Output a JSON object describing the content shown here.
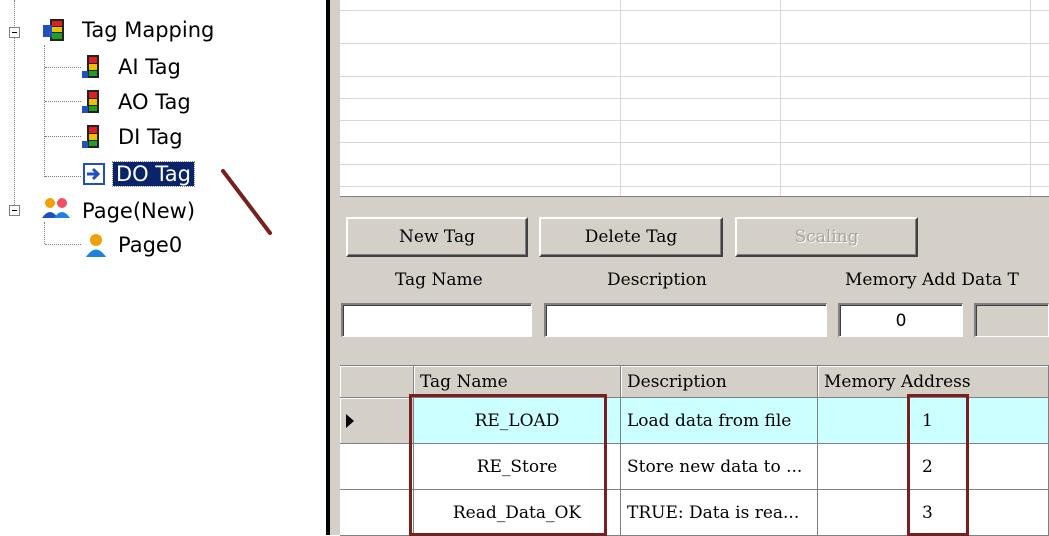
{
  "tree": {
    "nodes": [
      {
        "label": "Tag Mapping",
        "icon": "tag-mapping-icon"
      },
      {
        "label": "AI Tag",
        "icon": "tag-level-icon"
      },
      {
        "label": "AO Tag",
        "icon": "tag-level-icon"
      },
      {
        "label": "DI Tag",
        "icon": "tag-level-icon"
      },
      {
        "label": "DO Tag",
        "icon": "arrow-right-icon",
        "selected": true
      },
      {
        "label": "Page(New)",
        "icon": "users-group-icon"
      },
      {
        "label": "Page0",
        "icon": "user-icon"
      }
    ]
  },
  "toolbar": {
    "new_tag": "New Tag",
    "delete_tag": "Delete Tag",
    "scaling": "Scaling"
  },
  "form": {
    "tag_name_label": "Tag Name",
    "description_label": "Description",
    "memory_data_label": "Memory Add Data T",
    "tag_name_value": "",
    "description_value": "",
    "memory_value": "0",
    "data_type_value": ""
  },
  "table": {
    "headers": [
      "Tag Name",
      "Description",
      "Memory Address"
    ],
    "rows": [
      {
        "tag": "RE_LOAD",
        "desc": "Load data from file",
        "addr": "1"
      },
      {
        "tag": "RE_Store",
        "desc": "Store new data to ...",
        "addr": "2"
      },
      {
        "tag": "Read_Data_OK",
        "desc": "TRUE: Data is rea...",
        "addr": "3"
      }
    ]
  },
  "colors": {
    "selected_row": "#ccffff",
    "highlight_box": "#7a1f1f",
    "tree_selection": "#0a246a"
  }
}
